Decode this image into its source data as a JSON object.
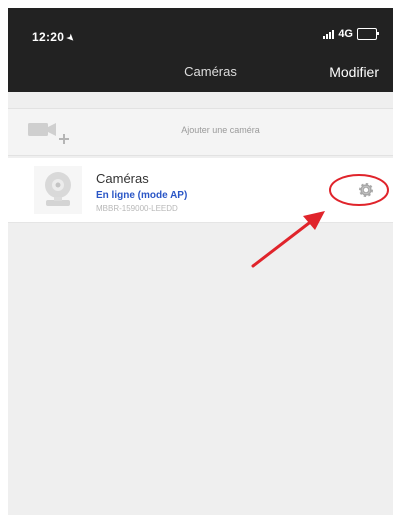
{
  "status_bar": {
    "time": "12:20",
    "network": "4G"
  },
  "nav": {
    "title": "Caméras",
    "right_button": "Modifier"
  },
  "add_camera": {
    "label": "Ajouter une caméra",
    "icon": "add-camera-icon"
  },
  "cameras": [
    {
      "name": "Caméras",
      "status": "En ligne (mode AP)",
      "id": "MBBR-159000-LEEDD",
      "settings_icon": "gear-icon"
    }
  ],
  "colors": {
    "header_bg": "#222222",
    "status_blue": "#2a56c6",
    "annotation_red": "#e0242b",
    "list_bg": "#efefef"
  }
}
